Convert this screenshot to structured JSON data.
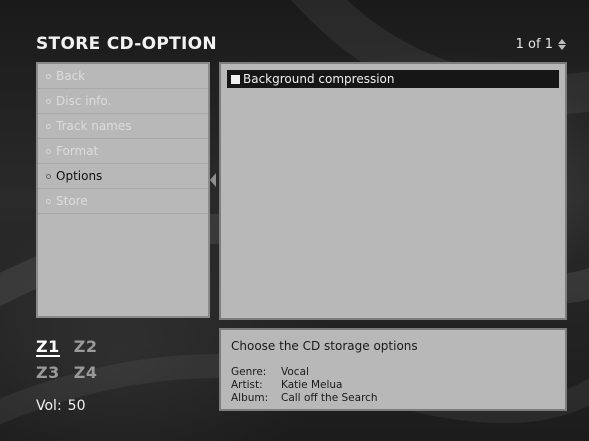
{
  "header": {
    "title": "STORE CD-OPTION",
    "pager": "1 of 1"
  },
  "menu": {
    "items": [
      {
        "label": "Back",
        "active": false
      },
      {
        "label": "Disc info.",
        "active": false
      },
      {
        "label": "Track names",
        "active": false
      },
      {
        "label": "Format",
        "active": false
      },
      {
        "label": "Options",
        "active": true
      },
      {
        "label": "Store",
        "active": false
      }
    ]
  },
  "content": {
    "options": [
      {
        "label": "Background compression",
        "selected": true,
        "checked": true
      }
    ]
  },
  "zones": {
    "items": [
      {
        "label": "Z1",
        "active": true
      },
      {
        "label": "Z2",
        "active": false
      },
      {
        "label": "Z3",
        "active": false
      },
      {
        "label": "Z4",
        "active": false
      }
    ]
  },
  "volume": {
    "label": "Vol:",
    "value": "50"
  },
  "info": {
    "headline": "Choose the CD storage options",
    "meta": [
      {
        "key": "Genre:",
        "value": "Vocal"
      },
      {
        "key": "Artist:",
        "value": "Katie Melua"
      },
      {
        "key": "Album:",
        "value": "Call off the Search"
      }
    ]
  }
}
